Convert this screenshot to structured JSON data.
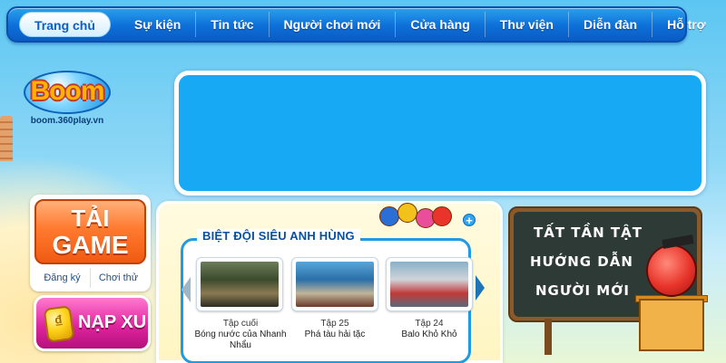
{
  "nav": {
    "items": [
      {
        "label": "Trang chủ",
        "active": true
      },
      {
        "label": "Sự kiện",
        "active": false
      },
      {
        "label": "Tin tức",
        "active": false
      },
      {
        "label": "Người chơi mới",
        "active": false
      },
      {
        "label": "Cửa hàng",
        "active": false
      },
      {
        "label": "Thư viện",
        "active": false
      },
      {
        "label": "Diễn đàn",
        "active": false
      },
      {
        "label": "Hỗ trợ",
        "active": false
      }
    ]
  },
  "logo": {
    "text": "Boom",
    "url": "boom.360play.vn"
  },
  "actions": {
    "download_line1": "TẢI",
    "download_line2": "GAME",
    "register": "Đăng ký",
    "play_trial": "Chơi thử",
    "topup": "NẠP XU"
  },
  "videos": {
    "section_title": "BIỆT ĐỘI SIÊU ANH HÙNG",
    "items": [
      {
        "episode": "Tập cuối",
        "title": "Bóng nước của Nhanh Nhẩu"
      },
      {
        "episode": "Tập 25",
        "title": "Phá tàu hải tặc"
      },
      {
        "episode": "Tập 24",
        "title": "Balo Khỏ Khỏ"
      }
    ]
  },
  "guide_board": {
    "line1": "TẤT TẦN TẬT",
    "line2": "HƯỚNG DẪN",
    "line3": "NGƯỜI MỚI"
  },
  "colors": {
    "nav_blue": "#0d6fd8",
    "banner_blue": "#18a9f5",
    "download_orange": "#ff7a2f",
    "topup_pink": "#e0259f"
  },
  "icons": {
    "plus": "+",
    "prev": "prev-arrow-icon",
    "next": "next-arrow-icon"
  }
}
